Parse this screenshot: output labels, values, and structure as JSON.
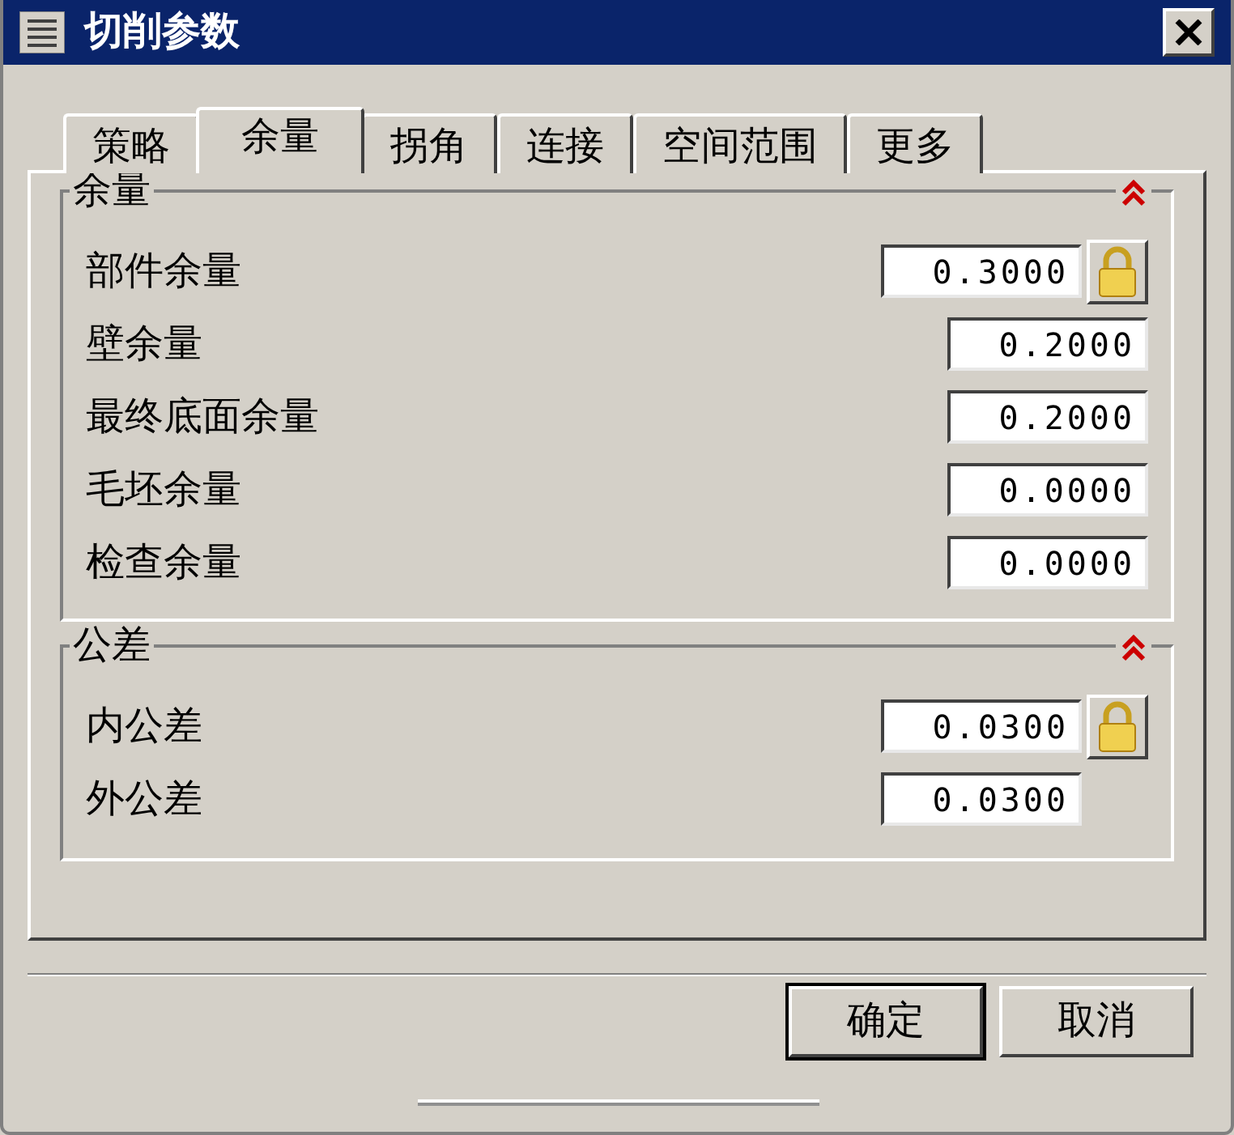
{
  "window": {
    "title": "切削参数"
  },
  "tabs": [
    {
      "label": "策略",
      "selected": false
    },
    {
      "label": "余量",
      "selected": true
    },
    {
      "label": "拐角",
      "selected": false
    },
    {
      "label": "连接",
      "selected": false
    },
    {
      "label": "空间范围",
      "selected": false
    },
    {
      "label": "更多",
      "selected": false
    }
  ],
  "groups": [
    {
      "kind": "stock",
      "title": "余量",
      "expanded": true,
      "rows": [
        {
          "label": "部件余量",
          "value": "0.3000",
          "lock": true
        },
        {
          "label": "壁余量",
          "value": "0.2000",
          "lock": false
        },
        {
          "label": "最终底面余量",
          "value": "0.2000",
          "lock": false
        },
        {
          "label": "毛坯余量",
          "value": "0.0000",
          "lock": false
        },
        {
          "label": "检查余量",
          "value": "0.0000",
          "lock": false
        }
      ]
    },
    {
      "kind": "tolerance",
      "title": "公差",
      "expanded": true,
      "rows": [
        {
          "label": "内公差",
          "value": "0.0300",
          "lock": true
        },
        {
          "label": "外公差",
          "value": "0.0300",
          "lock": false
        }
      ]
    }
  ],
  "buttons": [
    {
      "label": "确定",
      "default": true
    },
    {
      "label": "取消",
      "default": false
    }
  ]
}
